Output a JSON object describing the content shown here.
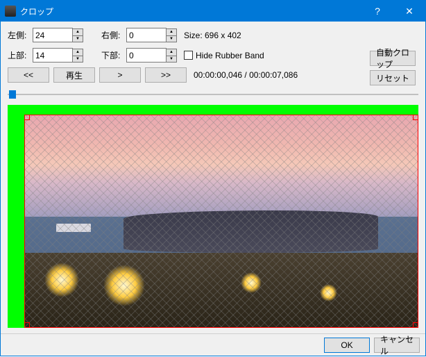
{
  "titlebar": {
    "title": "クロップ"
  },
  "inputs": {
    "left_label": "左側:",
    "left_value": "24",
    "right_label": "右側:",
    "right_value": "0",
    "top_label": "上部:",
    "top_value": "14",
    "bottom_label": "下部:",
    "bottom_value": "0"
  },
  "info": {
    "size_text": "Size: 696 x 402",
    "hide_rubber_band_label": "Hide Rubber Band",
    "hide_rubber_band_checked": false
  },
  "buttons": {
    "auto_crop": "自動クロップ",
    "reset": "リセット",
    "rewind": "<<",
    "play": "再生",
    "step_fwd": ">",
    "fast_fwd": ">>",
    "ok": "OK",
    "cancel": "キャンセル"
  },
  "timecode": "00:00:00,046 / 00:00:07,086",
  "slider": {
    "position_pct": 1
  }
}
